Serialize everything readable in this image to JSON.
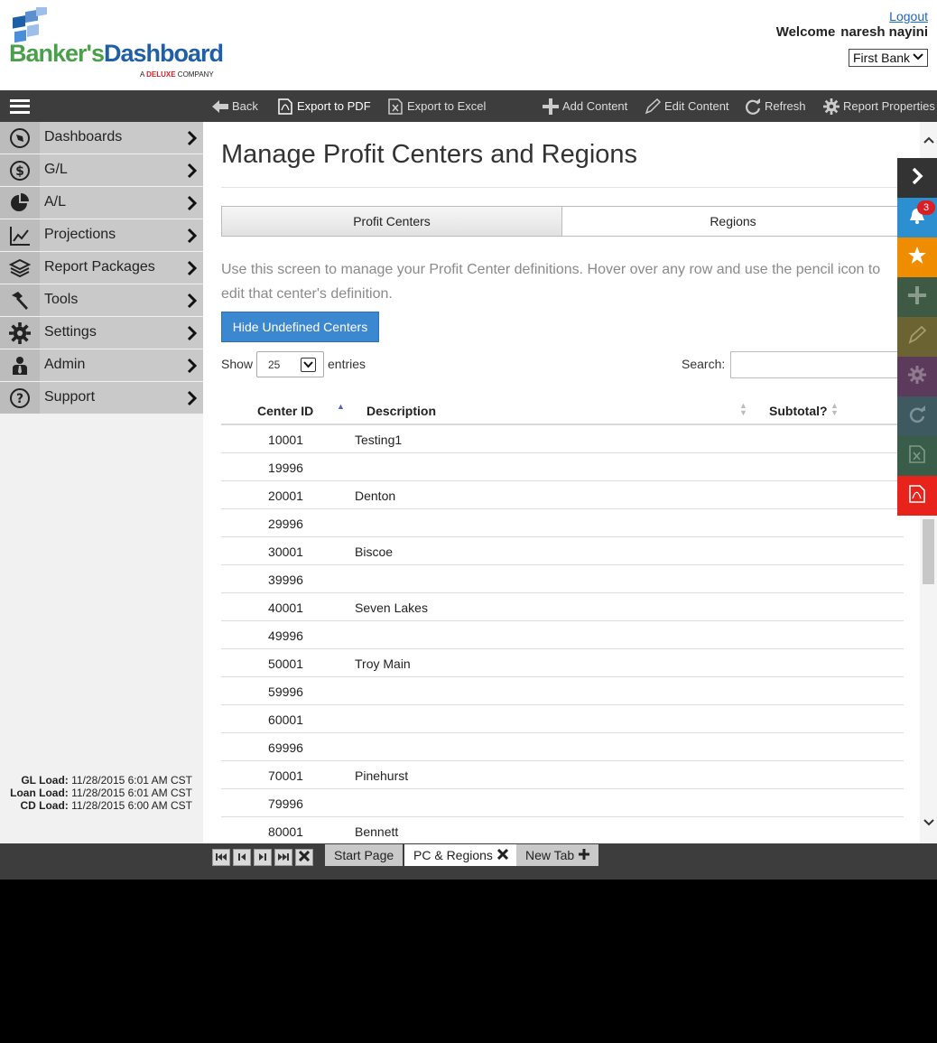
{
  "header": {
    "logo_part1": "Banker's",
    "logo_part2": "Dashboard",
    "logo_tagline_pre": "A ",
    "logo_tagline_brand": "DELUXE",
    "logo_tagline_post": " COMPANY",
    "logout": "Logout",
    "welcome": "Welcome",
    "user_name": "naresh nayini",
    "bank": "First Bank"
  },
  "toolbar": {
    "back": "Back",
    "export_pdf": "Export to PDF",
    "export_excel": "Export to Excel",
    "add_content": "Add Content",
    "edit_content": "Edit Content",
    "refresh": "Refresh",
    "report_properties": "Report Properties"
  },
  "sidebar": {
    "items": [
      {
        "label": "Dashboards",
        "icon": "compass-icon"
      },
      {
        "label": "G/L",
        "icon": "dollar-icon"
      },
      {
        "label": "A/L",
        "icon": "pie-chart-icon"
      },
      {
        "label": "Projections",
        "icon": "line-chart-icon"
      },
      {
        "label": "Report Packages",
        "icon": "layers-icon"
      },
      {
        "label": "Tools",
        "icon": "hammer-icon"
      },
      {
        "label": "Settings",
        "icon": "gear-icon"
      },
      {
        "label": "Admin",
        "icon": "user-tie-icon"
      },
      {
        "label": "Support",
        "icon": "question-icon"
      }
    ],
    "loads": {
      "gl_label": "GL Load:",
      "gl_value": "11/28/2015 6:01 AM CST",
      "loan_label": "Loan Load:",
      "loan_value": "11/28/2015 6:01 AM CST",
      "cd_label": "CD Load:",
      "cd_value": "11/28/2015 6:00 AM CST"
    }
  },
  "main": {
    "title": "Manage Profit Centers and Regions",
    "tabs": [
      {
        "label": "Profit Centers",
        "active": true
      },
      {
        "label": "Regions",
        "active": false
      }
    ],
    "intro": "Use this screen to manage your Profit Center definitions. Hover over any row and use the pencil icon to edit that center's definition.",
    "hide_button": "Hide Undefined Centers",
    "show_label": "Show",
    "page_length": "25",
    "entries_label": "entries",
    "search_label": "Search:",
    "search_value": "",
    "columns": [
      "Center ID",
      "Description",
      "Subtotal?"
    ],
    "rows": [
      {
        "id": "10001",
        "desc": "Testing1"
      },
      {
        "id": "19996",
        "desc": ""
      },
      {
        "id": "20001",
        "desc": "Denton"
      },
      {
        "id": "29996",
        "desc": ""
      },
      {
        "id": "30001",
        "desc": "Biscoe"
      },
      {
        "id": "39996",
        "desc": ""
      },
      {
        "id": "40001",
        "desc": "Seven Lakes"
      },
      {
        "id": "49996",
        "desc": ""
      },
      {
        "id": "50001",
        "desc": "Troy Main"
      },
      {
        "id": "59996",
        "desc": ""
      },
      {
        "id": "60001",
        "desc": ""
      },
      {
        "id": "69996",
        "desc": ""
      },
      {
        "id": "70001",
        "desc": "Pinehurst"
      },
      {
        "id": "79996",
        "desc": ""
      },
      {
        "id": "80001",
        "desc": "Bennett"
      }
    ]
  },
  "quick_panel": {
    "notifications_count": "3",
    "colors": {
      "expand": "#333333",
      "notifications": "#2d8fcf",
      "favorites": "#f08c00",
      "add": "#3e5a45",
      "edit": "#6b6331",
      "settings": "#5b3a5b",
      "refresh": "#3f5961",
      "excel": "#3a5d4a",
      "pdf": "#e8231c"
    }
  },
  "bottom_tabs": [
    {
      "label": "Start Page",
      "closable": false,
      "kind": "start"
    },
    {
      "label": "PC & Regions",
      "closable": true,
      "kind": "active"
    },
    {
      "label": "New Tab",
      "closable": false,
      "kind": "new"
    }
  ]
}
